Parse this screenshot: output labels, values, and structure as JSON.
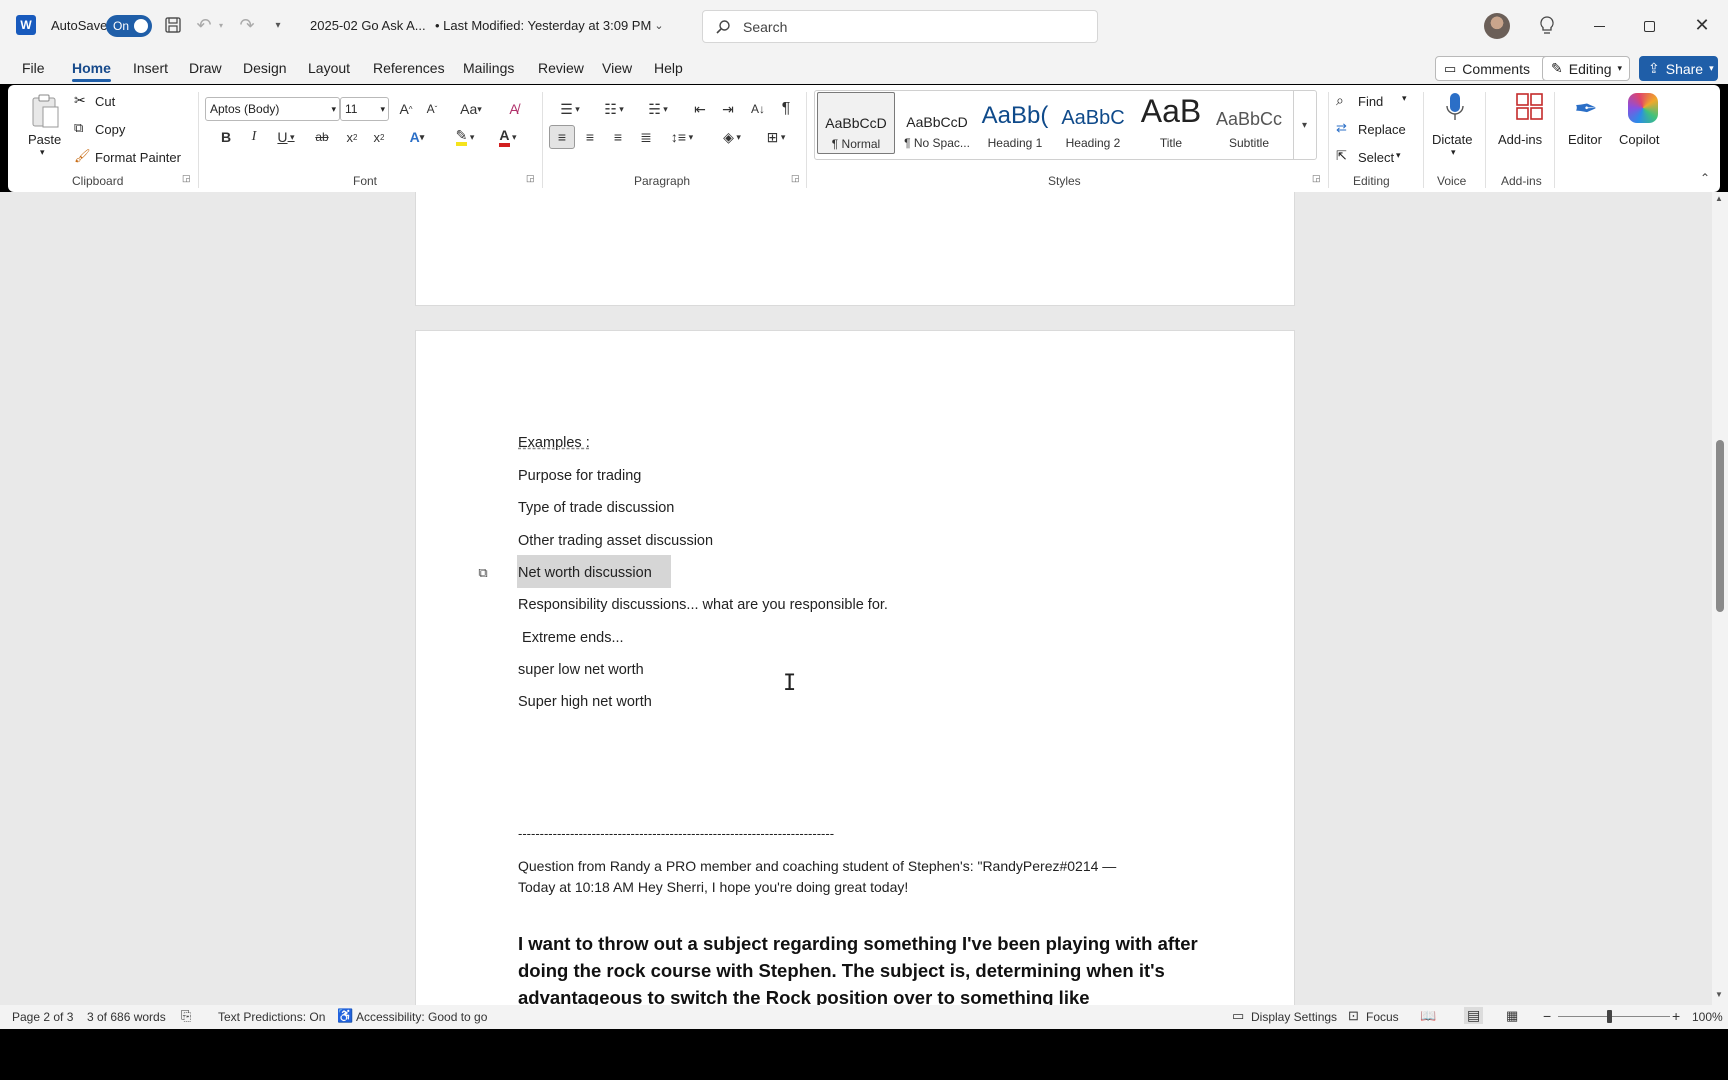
{
  "titlebar": {
    "autosave_label": "AutoSave",
    "autosave_state": "On",
    "doc_title": "2025-02 Go Ask A...",
    "last_modified": "• Last Modified: Yesterday at 3:09 PM",
    "search_placeholder": "Search"
  },
  "menu": {
    "tabs": [
      "File",
      "Home",
      "Insert",
      "Draw",
      "Design",
      "Layout",
      "References",
      "Mailings",
      "Review",
      "View",
      "Help"
    ],
    "comments": "Comments",
    "editing": "Editing",
    "share": "Share"
  },
  "ribbon": {
    "clipboard": {
      "paste": "Paste",
      "cut": "Cut",
      "copy": "Copy",
      "format_painter": "Format Painter",
      "group": "Clipboard"
    },
    "font": {
      "name": "Aptos (Body)",
      "size": "11",
      "group": "Font"
    },
    "paragraph": {
      "group": "Paragraph"
    },
    "styles": {
      "group": "Styles",
      "items": [
        {
          "preview": "AaBbCcD",
          "label": "¶ Normal"
        },
        {
          "preview": "AaBbCcD",
          "label": "¶ No Spac..."
        },
        {
          "preview": "AaBb(",
          "label": "Heading 1"
        },
        {
          "preview": "AaBbC",
          "label": "Heading 2"
        },
        {
          "preview": "AaB",
          "label": "Title"
        },
        {
          "preview": "AaBbCc",
          "label": "Subtitle"
        }
      ]
    },
    "editing": {
      "find": "Find",
      "replace": "Replace",
      "select": "Select",
      "group": "Editing"
    },
    "voice": {
      "dictate": "Dictate",
      "group": "Voice"
    },
    "addins": {
      "addins": "Add-ins",
      "group": "Add-ins"
    },
    "editor": "Editor",
    "copilot": "Copilot"
  },
  "document": {
    "examples_heading": "Examples :",
    "lines": [
      "Purpose for trading",
      "Type of trade discussion",
      "Other trading asset discussion",
      "Net worth discussion",
      "Responsibility discussions... what are you responsible for.",
      " Extreme ends...",
      "super low net worth",
      "Super high net worth"
    ],
    "divider": "-------------------------------------------------------------------------",
    "question_line1": "Question from Randy a PRO member and coaching student of Stephen's: \"RandyPerez#0214 —",
    "question_line2": "Today at 10:18 AM Hey Sherri, I hope you're doing great today!",
    "big_text": "I want to throw out a subject regarding something I've been playing with after doing the rock course with Stephen. The subject is, determining when it's advantageous to switch the Rock position over to something like"
  },
  "status": {
    "page": "Page 2 of 3",
    "words": "3 of 686 words",
    "text_predictions": "Text Predictions: On",
    "accessibility": "Accessibility: Good to go",
    "display_settings": "Display Settings",
    "focus": "Focus",
    "zoom": "100%"
  },
  "colors": {
    "accent": "#1f5ea8",
    "selection": "#d6d6d6"
  }
}
